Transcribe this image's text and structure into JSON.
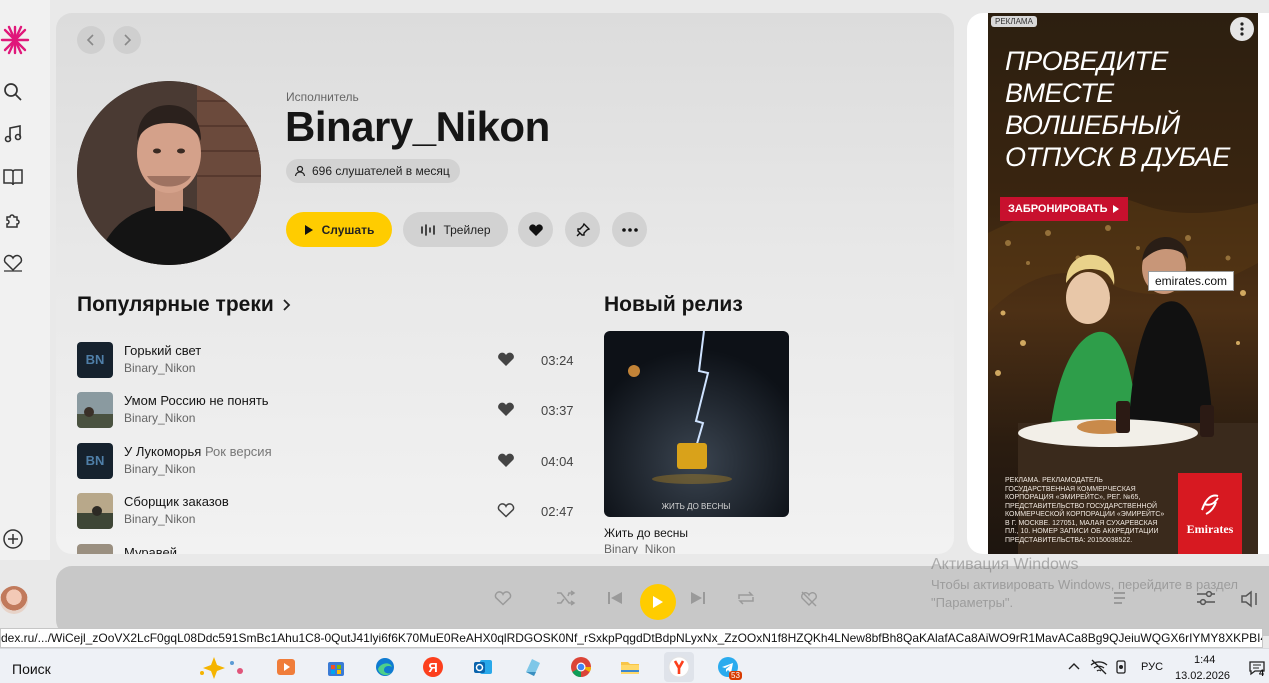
{
  "sidebar": {
    "logo": "yandex-music-star-logo",
    "items": [
      {
        "icon": "search-icon"
      },
      {
        "icon": "music-note-icon"
      },
      {
        "icon": "book-audio-icon"
      },
      {
        "icon": "kids-puzzle-icon"
      },
      {
        "icon": "heart-collection-icon"
      }
    ],
    "add_icon": "add-circle-icon"
  },
  "artist": {
    "type_label": "Исполнитель",
    "name": "Binary_Nikon",
    "listeners": "696 слушателей в месяц",
    "play_label": "Слушать",
    "trailer_label": "Трейлер"
  },
  "popular": {
    "title": "Популярные треки",
    "tracks": [
      {
        "title": "Горький свет",
        "version": "",
        "artist": "Binary_Nikon",
        "duration": "03:24",
        "liked": true
      },
      {
        "title": "Умом Россию не понять",
        "version": "",
        "artist": "Binary_Nikon",
        "duration": "03:37",
        "liked": true
      },
      {
        "title": "У Лукоморья",
        "version": "Рок версия",
        "artist": "Binary_Nikon",
        "duration": "04:04",
        "liked": true
      },
      {
        "title": "Сборщик заказов",
        "version": "",
        "artist": "Binary_Nikon",
        "duration": "02:47",
        "liked": false
      },
      {
        "title": "Муравей",
        "version": "",
        "artist": "",
        "duration": "",
        "liked": false
      }
    ]
  },
  "new_release": {
    "title": "Новый релиз",
    "cover_text": "ЖИТЬ ДО ВЕСНЫ",
    "album_title": "Жить до весны",
    "album_artist": "Binary_Nikon"
  },
  "ad": {
    "badge": "РЕКЛАМА",
    "headline": "ПРОВЕДИТЕ ВМЕСТЕ ВОЛШЕБНЫЙ ОТПУСК В ДУБАЕ",
    "cta": "ЗАБРОНИРОВАТЬ",
    "domain": "emirates.com",
    "legal": "РЕКЛАМА. РЕКЛАМОДАТЕЛЬ ГОСУДАРСТВЕННАЯ КОММЕРЧЕСКАЯ КОРПОРАЦИЯ «ЭМИРЕЙТС», РЕГ. №65, ПРЕДСТАВИТЕЛЬСТВО ГОСУДАРСТВЕННОЙ КОММЕРЧЕСКОЙ КОРПОРАЦИИ «ЭМИРЕЙТС» В Г. МОСКВЕ. 127051, МАЛАЯ СУХАРЕВСКАЯ ПЛ., 10. НОМЕР ЗАПИСИ ОБ АККРЕДИТАЦИИ ПРЕДСТАВИТЕЛЬСТВА: 20150038522.",
    "logo_text": "Emirates",
    "brand_color": "#d71921"
  },
  "activation": {
    "title": "Активация Windows",
    "text": "Чтобы активировать Windows, перейдите в раздел \"Параметры\"."
  },
  "status_url": "dex.ru/.../WiCejl_zOoVX2LcF0gqL08Ddc591SmBc1Ahu1C8-0QutJ41lyi6f6K70MuE0ReAHX0qlRDGOSK0Nf_rSxkpPqgdDtBdpNLyxNx_ZzOOxN1f8HZQKh4LNew8bfBh8QaKAlafACa8AiWO9rR1MavACa8Bg9QJeiuWQGX6rIYMY8XKPBI4...",
  "taskbar": {
    "search_label": "Поиск",
    "apps": [
      "media-player-icon",
      "store-icon",
      "edge-icon",
      "yandex-icon",
      "outlook-icon",
      "photos-icon",
      "chrome-icon",
      "explorer-icon",
      "yandex-browser-icon",
      "telegram-icon"
    ],
    "telegram_badge": "53",
    "lang": "РУС",
    "time": "1:44",
    "date": "13.02.2026",
    "notification_count": "4"
  },
  "colors": {
    "accent": "#ffcc00",
    "brand_red": "#d71921"
  }
}
